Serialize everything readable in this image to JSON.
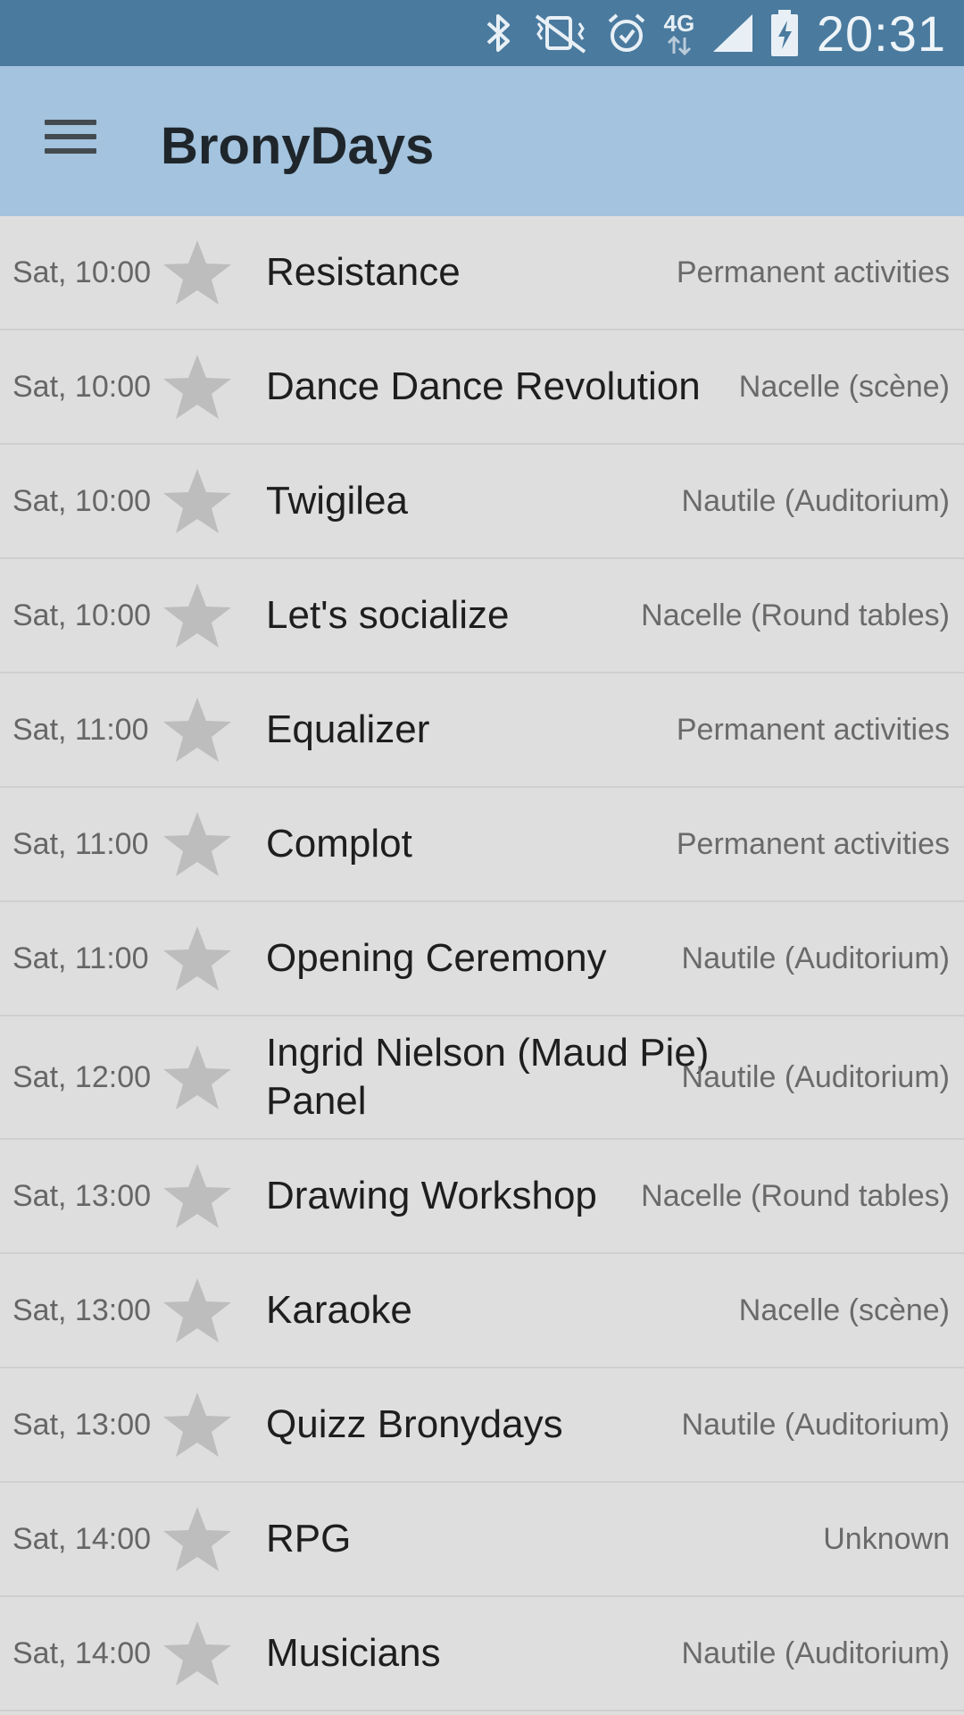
{
  "status_bar": {
    "network": "4G",
    "time": "20:31",
    "icons": [
      "bluetooth-icon",
      "vibrate-mute-icon",
      "alarm-icon",
      "network-4g-icon",
      "signal-icon",
      "battery-charging-icon"
    ]
  },
  "app_bar": {
    "title": "BronyDays",
    "menu_icon": "hamburger-menu-icon"
  },
  "colors": {
    "status_bar": "#4a7a9e",
    "app_bar": "#a3c3de",
    "list_background": "#dedede",
    "star": "#bdbdbd"
  },
  "events": [
    {
      "time": "Sat, 10:00",
      "title": "Resistance",
      "venue": "Permanent activities",
      "favorite": false
    },
    {
      "time": "Sat, 10:00",
      "title": "Dance Dance Revolution",
      "venue": "Nacelle (scène)",
      "favorite": false
    },
    {
      "time": "Sat, 10:00",
      "title": "Twigilea",
      "venue": "Nautile (Auditorium)",
      "favorite": false
    },
    {
      "time": "Sat, 10:00",
      "title": "Let's socialize",
      "venue": "Nacelle (Round tables)",
      "favorite": false
    },
    {
      "time": "Sat, 11:00",
      "title": "Equalizer",
      "venue": "Permanent activities",
      "favorite": false
    },
    {
      "time": "Sat, 11:00",
      "title": "Complot",
      "venue": "Permanent activities",
      "favorite": false
    },
    {
      "time": "Sat, 11:00",
      "title": "Opening Ceremony",
      "venue": "Nautile (Auditorium)",
      "favorite": false
    },
    {
      "time": "Sat, 12:00",
      "title": "Ingrid Nielson (Maud Pie) Panel",
      "venue": "Nautile (Auditorium)",
      "favorite": false
    },
    {
      "time": "Sat, 13:00",
      "title": "Drawing Workshop",
      "venue": "Nacelle (Round tables)",
      "favorite": false
    },
    {
      "time": "Sat, 13:00",
      "title": "Karaoke",
      "venue": "Nacelle (scène)",
      "favorite": false
    },
    {
      "time": "Sat, 13:00",
      "title": "Quizz Bronydays",
      "venue": "Nautile (Auditorium)",
      "favorite": false
    },
    {
      "time": "Sat, 14:00",
      "title": "RPG",
      "venue": "Unknown",
      "favorite": false
    },
    {
      "time": "Sat, 14:00",
      "title": "Musicians",
      "venue": "Nautile (Auditorium)",
      "favorite": false
    }
  ]
}
